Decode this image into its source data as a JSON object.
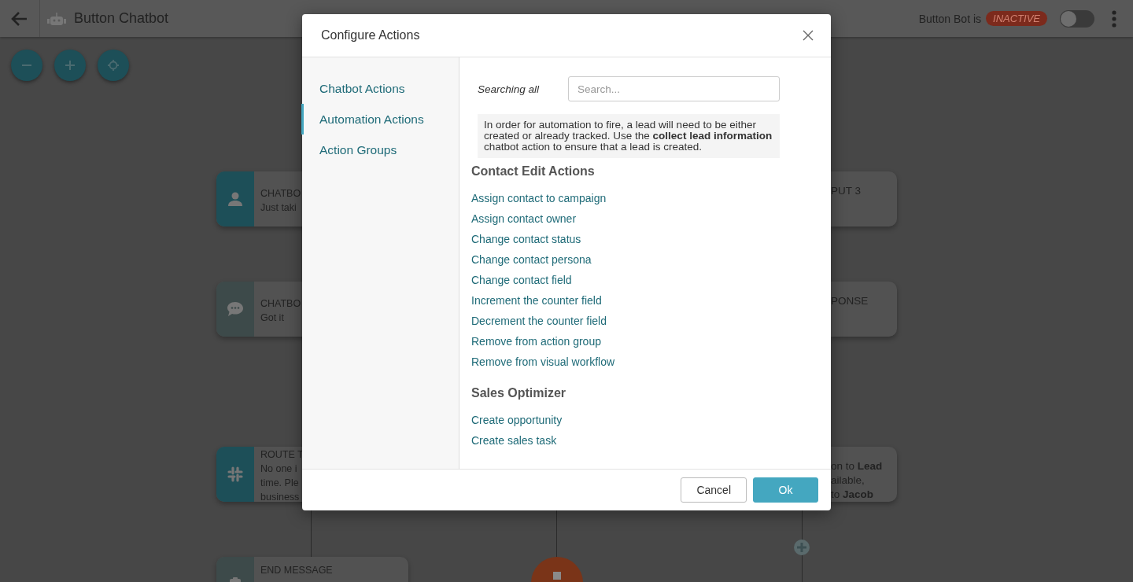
{
  "topbar": {
    "title": "Button Chatbot",
    "status_label": "Button Bot is",
    "status_badge": "INACTIVE",
    "bot_active": {
      "on": false
    }
  },
  "canvas": {
    "left_nodes": [
      {
        "kind": "person",
        "title": "CHATBO",
        "lines": [
          "Just taki"
        ]
      },
      {
        "kind": "chat",
        "title": "CHATBO",
        "lines": [
          "Got it"
        ]
      },
      {
        "kind": "slack",
        "title": "ROUTE T",
        "lines": [
          "No one i",
          "time. Ple",
          "business"
        ]
      },
      {
        "kind": "clipboard",
        "title": "END MESSAGE"
      }
    ],
    "right_nodes": [
      {
        "lines": [
          "PUT 3"
        ]
      },
      {
        "lines": [
          "PONSE"
        ]
      },
      {
        "lines": [
          "on to **Lead**",
          "ailable,",
          "to **Jacob**"
        ]
      }
    ]
  },
  "modal": {
    "title": "Configure Actions",
    "nav": [
      {
        "label": "Chatbot Actions",
        "selected": false
      },
      {
        "label": "Automation Actions",
        "selected": true
      },
      {
        "label": "Action Groups",
        "selected": false
      }
    ],
    "search_label": "Searching all",
    "search": {
      "placeholder": "Search..."
    },
    "notice": "In order for automation to fire, a lead will need to be either created or already tracked. Use the **collect lead information** chatbot action to ensure that a lead is created.",
    "sections": [
      {
        "title": "Contact Edit Actions",
        "actions": [
          "Assign contact to campaign",
          "Assign contact owner",
          "Change contact status",
          "Change contact persona",
          "Change contact field",
          "Increment the counter field",
          "Decrement the counter field",
          "Remove from action group",
          "Remove from visual workflow"
        ]
      },
      {
        "title": "Sales Optimizer",
        "actions": [
          "Create opportunity",
          "Create sales task"
        ]
      }
    ],
    "buttons": [
      {
        "label": "Cancel",
        "kind": "secondary"
      },
      {
        "label": "Ok",
        "kind": "primary"
      }
    ]
  }
}
